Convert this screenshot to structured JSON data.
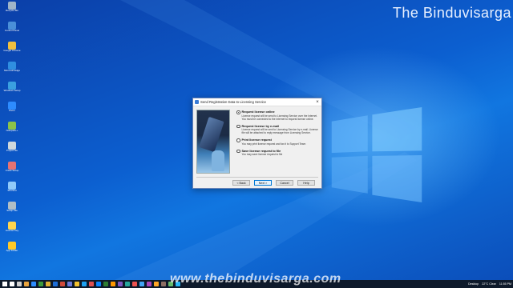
{
  "watermark": {
    "top": "The Binduvisarga",
    "bottom": "www.thebinduvisarga.com"
  },
  "desktop_icons": [
    {
      "label": "Recycle Bin",
      "color": "#9fb4c8"
    },
    {
      "label": "Control Panel",
      "color": "#4a8fd8"
    },
    {
      "label": "Google Chrome",
      "color": "#f0c040"
    },
    {
      "label": "Microsoft Edge",
      "color": "#2f8ee0"
    },
    {
      "label": "Windows Setup",
      "color": "#3aa0e0"
    },
    {
      "label": "Zoom",
      "color": "#2d8cff"
    },
    {
      "label": "Notepad++",
      "color": "#8bc34a"
    },
    {
      "label": "Project file",
      "color": "#cfd8dc"
    },
    {
      "label": "Crack Setup",
      "color": "#e57373"
    },
    {
      "label": "Shortcut",
      "color": "#90caf9"
    },
    {
      "label": "Setup File",
      "color": "#b0bec5"
    },
    {
      "label": "License Key",
      "color": "#ffd54f"
    },
    {
      "label": "App Folder",
      "color": "#ffca28"
    }
  ],
  "dialog": {
    "title": "Send Registration Data to Licensing Service",
    "close": "×",
    "options": [
      {
        "title": "Request license online",
        "desc": "License request will be send to Licensing Service over the Internet. You must be connected to the Internet to request license online.",
        "checked": true
      },
      {
        "title": "Request license by e-mail",
        "desc": "License request will be sent to Licensing Service by e-mail. License file will be attached to reply message from Licensing Service.",
        "checked": false
      },
      {
        "title": "Print license request",
        "desc": "You may print license request and fax it to Support Team",
        "checked": false
      },
      {
        "title": "Save license request to file",
        "desc": "You may save license request to file",
        "checked": false
      }
    ],
    "buttons": {
      "back": "< Back",
      "next": "Next >",
      "cancel": "Cancel",
      "help": "Help"
    }
  },
  "taskbar": {
    "desktop_label": "Desktop",
    "weather": "22°C Clear",
    "time": "11:55 PM",
    "icon_colors": [
      "#ffffff",
      "#d0d0d0",
      "#e8a33d",
      "#2d8cff",
      "#3c9b3c",
      "#e0b030",
      "#1e6fd9",
      "#d04a3a",
      "#6a7bdc",
      "#f2c12e",
      "#1da1f2",
      "#e05050",
      "#0a84ff",
      "#2e7d32",
      "#ff9800",
      "#7e57c2",
      "#26a69a",
      "#ef5350",
      "#42a5f5",
      "#ab47bc",
      "#ffa726",
      "#8d6e63",
      "#66bb6a",
      "#29b6f6"
    ]
  }
}
